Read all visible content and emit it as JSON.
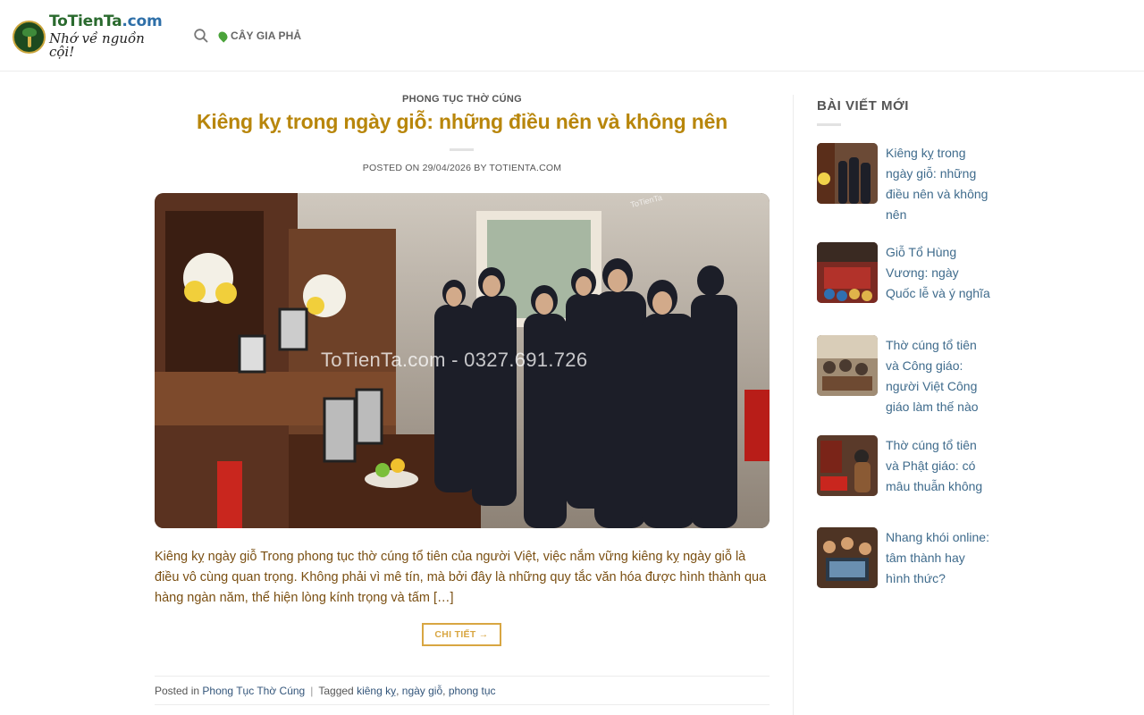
{
  "site": {
    "logo_name_1": "ToTienTa",
    "logo_name_2": ".com",
    "slogan": "Nhớ về nguồn cội!"
  },
  "nav": {
    "search_icon": "search-icon",
    "items": [
      {
        "label": "CÂY GIA PHẢ",
        "icon": "leaf-icon"
      }
    ]
  },
  "article": {
    "category": "PHONG TỤC THỜ CÚNG",
    "title": "Kiêng kỵ trong ngày giỗ: những điều nên và không nên",
    "meta_prefix": "POSTED ON",
    "meta_date": "29/04/2026",
    "meta_by": "BY",
    "meta_author": "TOTIENTA.COM",
    "image_watermark": "ToTienTa.com - 0327.691.726",
    "image_watermark_small": "ToTienTa",
    "excerpt": "Kiêng kỵ ngày giỗ Trong phong tục thờ cúng tổ tiên của người Việt, việc nắm vững kiêng kỵ ngày giỗ là điều vô cùng quan trọng. Không phải vì mê tín, mà bởi đây là những quy tắc văn hóa được hình thành qua hàng ngàn năm, thể hiện lòng kính trọng và tấm […]",
    "read_more": "CHI TIẾT →",
    "posted_in_label": "Posted in",
    "posted_in_category": "Phong Tục Thờ Cúng",
    "separator": "|",
    "tagged_label": "Tagged",
    "tags": [
      "kiêng kỵ",
      "ngày giỗ",
      "phong tục"
    ]
  },
  "sidebar": {
    "widget_title": "BÀI VIẾT MỚI",
    "posts": [
      {
        "title": "Kiêng kỵ trong ngày giỗ: những điều nên và không nên"
      },
      {
        "title": "Giỗ Tổ Hùng Vương: ngày Quốc lễ và ý nghĩa"
      },
      {
        "title": "Thờ cúng tổ tiên và Công giáo: người Việt Công giáo làm thế nào"
      },
      {
        "title": "Thờ cúng tổ tiên và Phật giáo: có mâu thuẫn không"
      },
      {
        "title": "Nhang khói online: tâm thành hay hình thức?"
      }
    ]
  },
  "colors": {
    "title": "#b8860b",
    "excerpt": "#7a4f12",
    "button": "#d8a642",
    "link": "#3f6b8c",
    "logo_green": "#2a6a2e"
  }
}
